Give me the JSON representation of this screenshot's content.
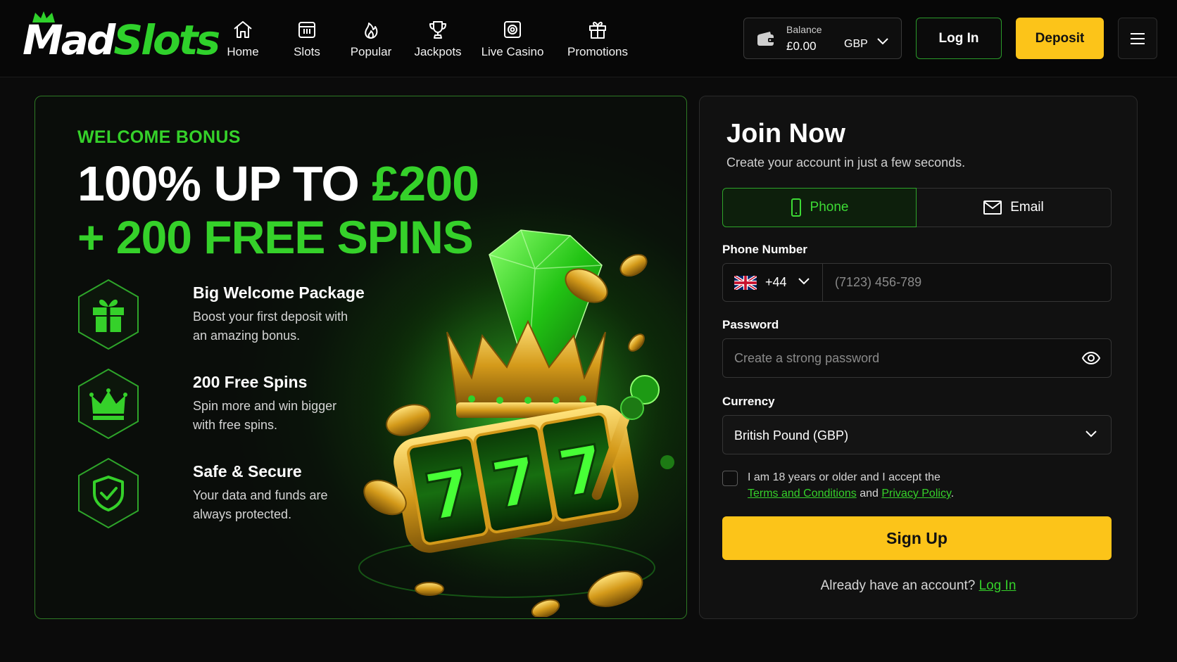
{
  "header": {
    "logo": {
      "part1": "Mad",
      "part2": "Slots"
    },
    "nav": [
      {
        "label": "Home",
        "icon": "home-icon"
      },
      {
        "label": "Slots",
        "icon": "slot-machine-icon"
      },
      {
        "label": "Popular",
        "icon": "flame-icon"
      },
      {
        "label": "Jackpots",
        "icon": "trophy-icon"
      },
      {
        "label": "Live Casino",
        "icon": "live-camera-icon"
      },
      {
        "label": "Promotions",
        "icon": "gift-icon"
      }
    ],
    "balance": {
      "label": "Balance",
      "value": "£0.00",
      "currency": "GBP",
      "icon": "wallet-icon"
    },
    "login_label": "Log In",
    "deposit_label": "Deposit",
    "menu_icon": "hamburger-menu-icon"
  },
  "promo": {
    "eyebrow": "WELCOME BONUS",
    "headline_part1": "100% UP TO ",
    "headline_amount": "£200",
    "headline_line2": "+ 200 FREE SPINS",
    "features": [
      {
        "title": "Big Welcome Package",
        "desc": "Boost your first deposit with an amazing bonus.",
        "icon": "gift-icon"
      },
      {
        "title": "200 Free Spins",
        "desc": "Spin more and win bigger with free spins.",
        "icon": "crown-icon"
      },
      {
        "title": "Safe & Secure",
        "desc": "Your data and funds are always protected.",
        "icon": "shield-check-icon"
      }
    ],
    "slot_reels": [
      "7",
      "7",
      "7"
    ]
  },
  "signup": {
    "title": "Join Now",
    "subtitle": "Create your account in just a few seconds.",
    "tabs": {
      "phone": "Phone",
      "email": "Email"
    },
    "phone_label": "Phone Number",
    "country_code": "+44",
    "phone_placeholder": "(7123) 456-789",
    "password_label": "Password",
    "password_placeholder": "Create a strong password",
    "currency_label": "Currency",
    "currency_value": "British Pound (GBP)",
    "terms_prefix": "I am 18 years or older and I accept the",
    "terms_link": "Terms and Conditions",
    "terms_and": "and",
    "privacy_link": "Privacy Policy",
    "terms_suffix": ".",
    "signup_label": "Sign Up",
    "already_text": "Already have an account?",
    "already_link": "Log In"
  },
  "colors": {
    "accent_green": "#35d12a",
    "cta_yellow": "#fcc419",
    "background": "#0b0b0b",
    "panel": "#111111"
  }
}
